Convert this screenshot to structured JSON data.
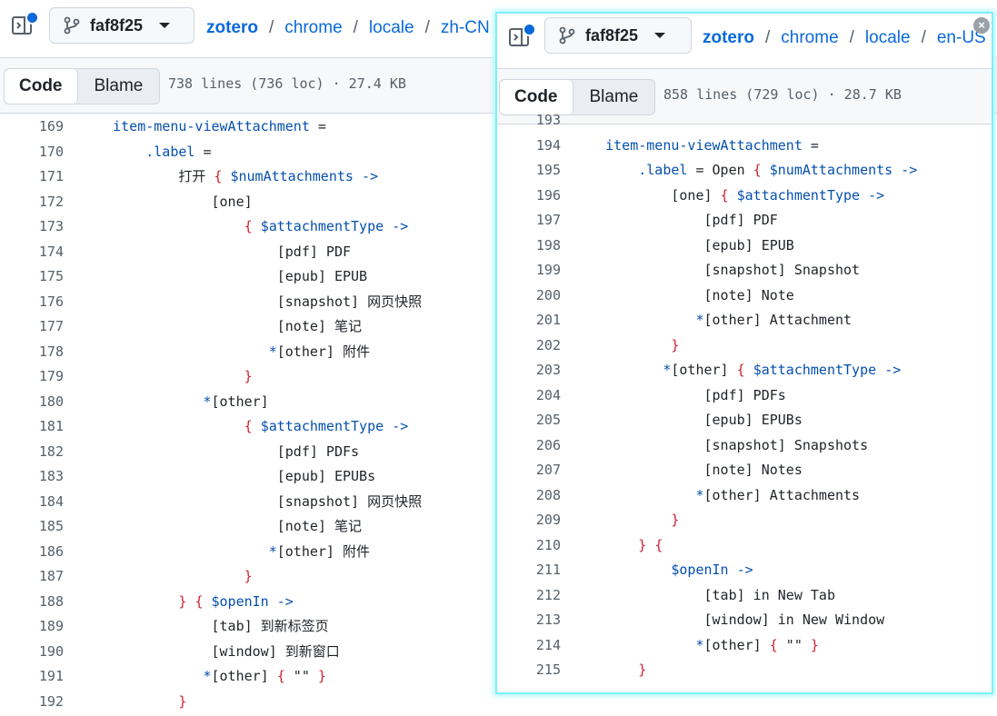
{
  "left": {
    "branch": "faf8f25",
    "breadcrumb": [
      "zotero",
      "chrome",
      "locale",
      "zh-CN"
    ],
    "tabs": [
      "Code",
      "Blame"
    ],
    "stats": "738 lines (736 loc) · 27.4 KB",
    "lines": [
      {
        "n": "169",
        "t": "    item-menu-viewAttachment ="
      },
      {
        "n": "170",
        "t": "        .label ="
      },
      {
        "n": "171",
        "t": "            打开 { $numAttachments ->"
      },
      {
        "n": "172",
        "t": "                [one]"
      },
      {
        "n": "173",
        "t": "                    { $attachmentType ->"
      },
      {
        "n": "174",
        "t": "                        [pdf] PDF"
      },
      {
        "n": "175",
        "t": "                        [epub] EPUB"
      },
      {
        "n": "176",
        "t": "                        [snapshot] 网页快照"
      },
      {
        "n": "177",
        "t": "                        [note] 笔记"
      },
      {
        "n": "178",
        "t": "                       *[other] 附件"
      },
      {
        "n": "179",
        "t": "                    }"
      },
      {
        "n": "180",
        "t": "               *[other]"
      },
      {
        "n": "181",
        "t": "                    { $attachmentType ->"
      },
      {
        "n": "182",
        "t": "                        [pdf] PDFs"
      },
      {
        "n": "183",
        "t": "                        [epub] EPUBs"
      },
      {
        "n": "184",
        "t": "                        [snapshot] 网页快照"
      },
      {
        "n": "185",
        "t": "                        [note] 笔记"
      },
      {
        "n": "186",
        "t": "                       *[other] 附件"
      },
      {
        "n": "187",
        "t": "                    }"
      },
      {
        "n": "188",
        "t": "            } { $openIn ->"
      },
      {
        "n": "189",
        "t": "                [tab] 到新标签页"
      },
      {
        "n": "190",
        "t": "                [window] 到新窗口"
      },
      {
        "n": "191",
        "t": "               *[other] { \"\" }"
      },
      {
        "n": "192",
        "t": "            }"
      }
    ]
  },
  "right": {
    "branch": "faf8f25",
    "breadcrumb": [
      "zotero",
      "chrome",
      "locale",
      "en-US"
    ],
    "tabs": [
      "Code",
      "Blame"
    ],
    "stats": "858 lines (729 loc) · 28.7 KB",
    "lines": [
      {
        "n": "193",
        "t": ""
      },
      {
        "n": "194",
        "t": "    item-menu-viewAttachment ="
      },
      {
        "n": "195",
        "t": "        .label = Open { $numAttachments ->"
      },
      {
        "n": "196",
        "t": "            [one] { $attachmentType ->"
      },
      {
        "n": "197",
        "t": "                [pdf] PDF"
      },
      {
        "n": "198",
        "t": "                [epub] EPUB"
      },
      {
        "n": "199",
        "t": "                [snapshot] Snapshot"
      },
      {
        "n": "200",
        "t": "                [note] Note"
      },
      {
        "n": "201",
        "t": "               *[other] Attachment"
      },
      {
        "n": "202",
        "t": "            }"
      },
      {
        "n": "203",
        "t": "           *[other] { $attachmentType ->"
      },
      {
        "n": "204",
        "t": "                [pdf] PDFs"
      },
      {
        "n": "205",
        "t": "                [epub] EPUBs"
      },
      {
        "n": "206",
        "t": "                [snapshot] Snapshots"
      },
      {
        "n": "207",
        "t": "                [note] Notes"
      },
      {
        "n": "208",
        "t": "               *[other] Attachments"
      },
      {
        "n": "209",
        "t": "            }"
      },
      {
        "n": "210",
        "t": "        } {"
      },
      {
        "n": "211",
        "t": "            $openIn ->"
      },
      {
        "n": "212",
        "t": "                [tab] in New Tab"
      },
      {
        "n": "213",
        "t": "                [window] in New Window"
      },
      {
        "n": "214",
        "t": "               *[other] { \"\" }"
      },
      {
        "n": "215",
        "t": "        }"
      }
    ]
  },
  "colors": {
    "link": "#0969da",
    "keyword": "#0550ae",
    "brace": "#cf222e",
    "highlight": "#7ef0f5"
  },
  "icons": {
    "sidebar": "sidebar-expand-icon",
    "branch": "git-branch-icon",
    "close": "close-icon"
  }
}
